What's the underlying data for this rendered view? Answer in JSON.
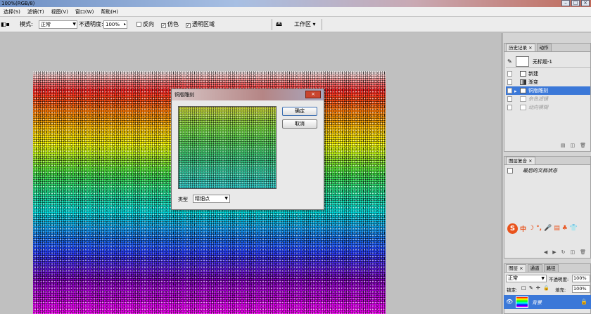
{
  "window": {
    "title": "100%(RGB/8)",
    "controls": [
      "–",
      "□",
      "×"
    ]
  },
  "menu": [
    "选择(S)",
    "滤镜(T)",
    "视图(V)",
    "窗口(W)",
    "帮助(H)"
  ],
  "options": {
    "mode_label": "模式:",
    "mode_value": "正常",
    "opacity_label": "不透明度:",
    "opacity_value": "100%",
    "reverse_label": "反向",
    "dither_label": "仿色",
    "dither_checked": true,
    "transparency_label": "透明区域",
    "transparency_checked": true,
    "workspace_label": "工作区"
  },
  "dialog": {
    "title": "铜版雕刻",
    "close_label": "×",
    "ok_label": "确定",
    "cancel_label": "取消",
    "type_label": "类型",
    "type_value": "精细点"
  },
  "history": {
    "tabs": [
      "历史记录 ×",
      "动作"
    ],
    "snapshot_label": "无标题-1",
    "items": [
      {
        "label": "新建",
        "state": "normal"
      },
      {
        "label": "渐变",
        "state": "normal"
      },
      {
        "label": "铜版雕刻",
        "state": "selected"
      },
      {
        "label": "杂色滤镜",
        "state": "dim"
      },
      {
        "label": "动向模糊",
        "state": "dim"
      }
    ]
  },
  "comp": {
    "tabs": [
      "图层复合 ×"
    ],
    "item_label": "最后的文档状态"
  },
  "layers": {
    "tabs": [
      "图层 ×",
      "通道",
      "路径"
    ],
    "blend_value": "正常",
    "opacity_label": "不透明度:",
    "opacity_value": "100%",
    "lock_label": "锁定:",
    "fill_label": "填充:",
    "fill_value": "100%",
    "layer_name": "背景"
  },
  "ime": {
    "items": [
      "中",
      "☽",
      "°,",
      "🎤",
      "▤",
      "♣",
      "👕"
    ]
  },
  "colors": {
    "selection": "#3b78d8",
    "dialog_close": "#c9452f",
    "ime_brand": "#e9531c"
  }
}
